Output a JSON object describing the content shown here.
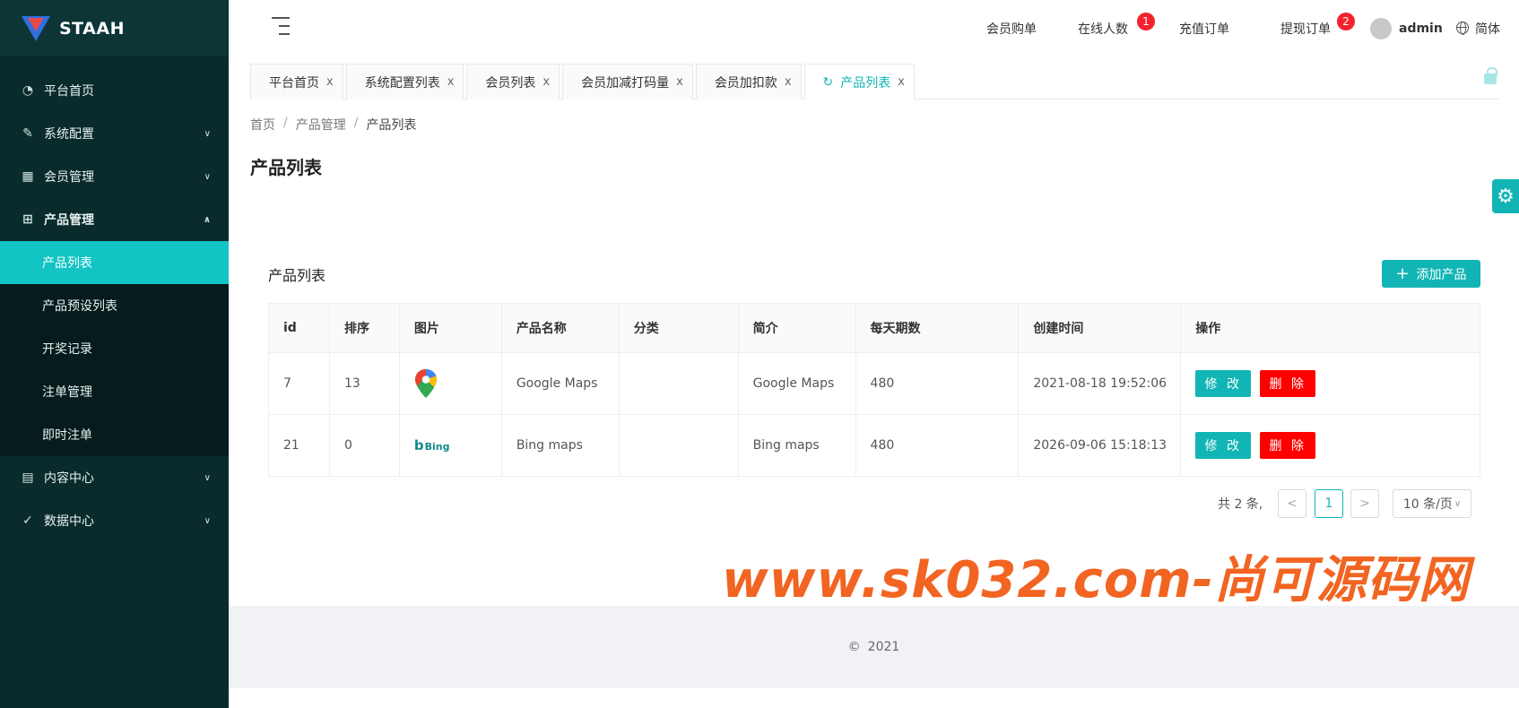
{
  "brand": {
    "name": "STAAH",
    "colors": {
      "accent": "#12b5b5",
      "danger": "#ff0000",
      "sidebar": "#0a2b2b"
    }
  },
  "sidebar": {
    "items": [
      {
        "label": "平台首页",
        "icon": "dashboard-icon"
      },
      {
        "label": "系统配置",
        "icon": "edit-icon"
      },
      {
        "label": "会员管理",
        "icon": "table-icon"
      },
      {
        "label": "产品管理",
        "icon": "grid-icon"
      },
      {
        "label": "内容中心",
        "icon": "document-icon"
      },
      {
        "label": "数据中心",
        "icon": "check-circle-icon"
      }
    ],
    "sub_items": [
      "产品列表",
      "产品预设列表",
      "开奖记录",
      "注单管理",
      "即时注单"
    ]
  },
  "header": {
    "nav": [
      {
        "label": "会员购单"
      },
      {
        "label": "在线人数",
        "badge": "1"
      },
      {
        "label": "充值订单"
      },
      {
        "label": "提现订单",
        "badge": "2"
      }
    ],
    "user": "admin",
    "language": "简体"
  },
  "tabs": [
    {
      "label": "平台首页"
    },
    {
      "label": "系统配置列表"
    },
    {
      "label": "会员列表"
    },
    {
      "label": "会员加减打码量"
    },
    {
      "label": "会员加扣款"
    },
    {
      "label": "产品列表"
    }
  ],
  "tab_close": "x",
  "breadcrumb": [
    "首页",
    "产品管理",
    "产品列表"
  ],
  "breadcrumb_sep": "/",
  "page_title": "产品列表",
  "card": {
    "title": "产品列表",
    "add_button": "添加产品",
    "columns": [
      "id",
      "排序",
      "图片",
      "产品名称",
      "分类",
      "简介",
      "每天期数",
      "创建时间",
      "操作"
    ],
    "rows": [
      {
        "id": "7",
        "sort": "13",
        "image": "google-maps-icon",
        "name": "Google Maps",
        "category": "",
        "intro": "Google Maps",
        "periods": "480",
        "created": "2021-08-18 19:52:06"
      },
      {
        "id": "21",
        "sort": "0",
        "image": "bing-logo",
        "image_text": "Bing",
        "name": "Bing maps",
        "category": "",
        "intro": "Bing maps",
        "periods": "480",
        "created": "2026-09-06 15:18:13"
      }
    ],
    "edit_label": "修 改",
    "delete_label": "删 除"
  },
  "pagination": {
    "total_text": "共 2 条,",
    "current_page": "1",
    "page_size": "10 条/页",
    "prev": "<",
    "next": ">"
  },
  "watermark": "www.sk032.com-尚可源码网",
  "footer": {
    "copyright_symbol": "©",
    "year": "2021"
  }
}
